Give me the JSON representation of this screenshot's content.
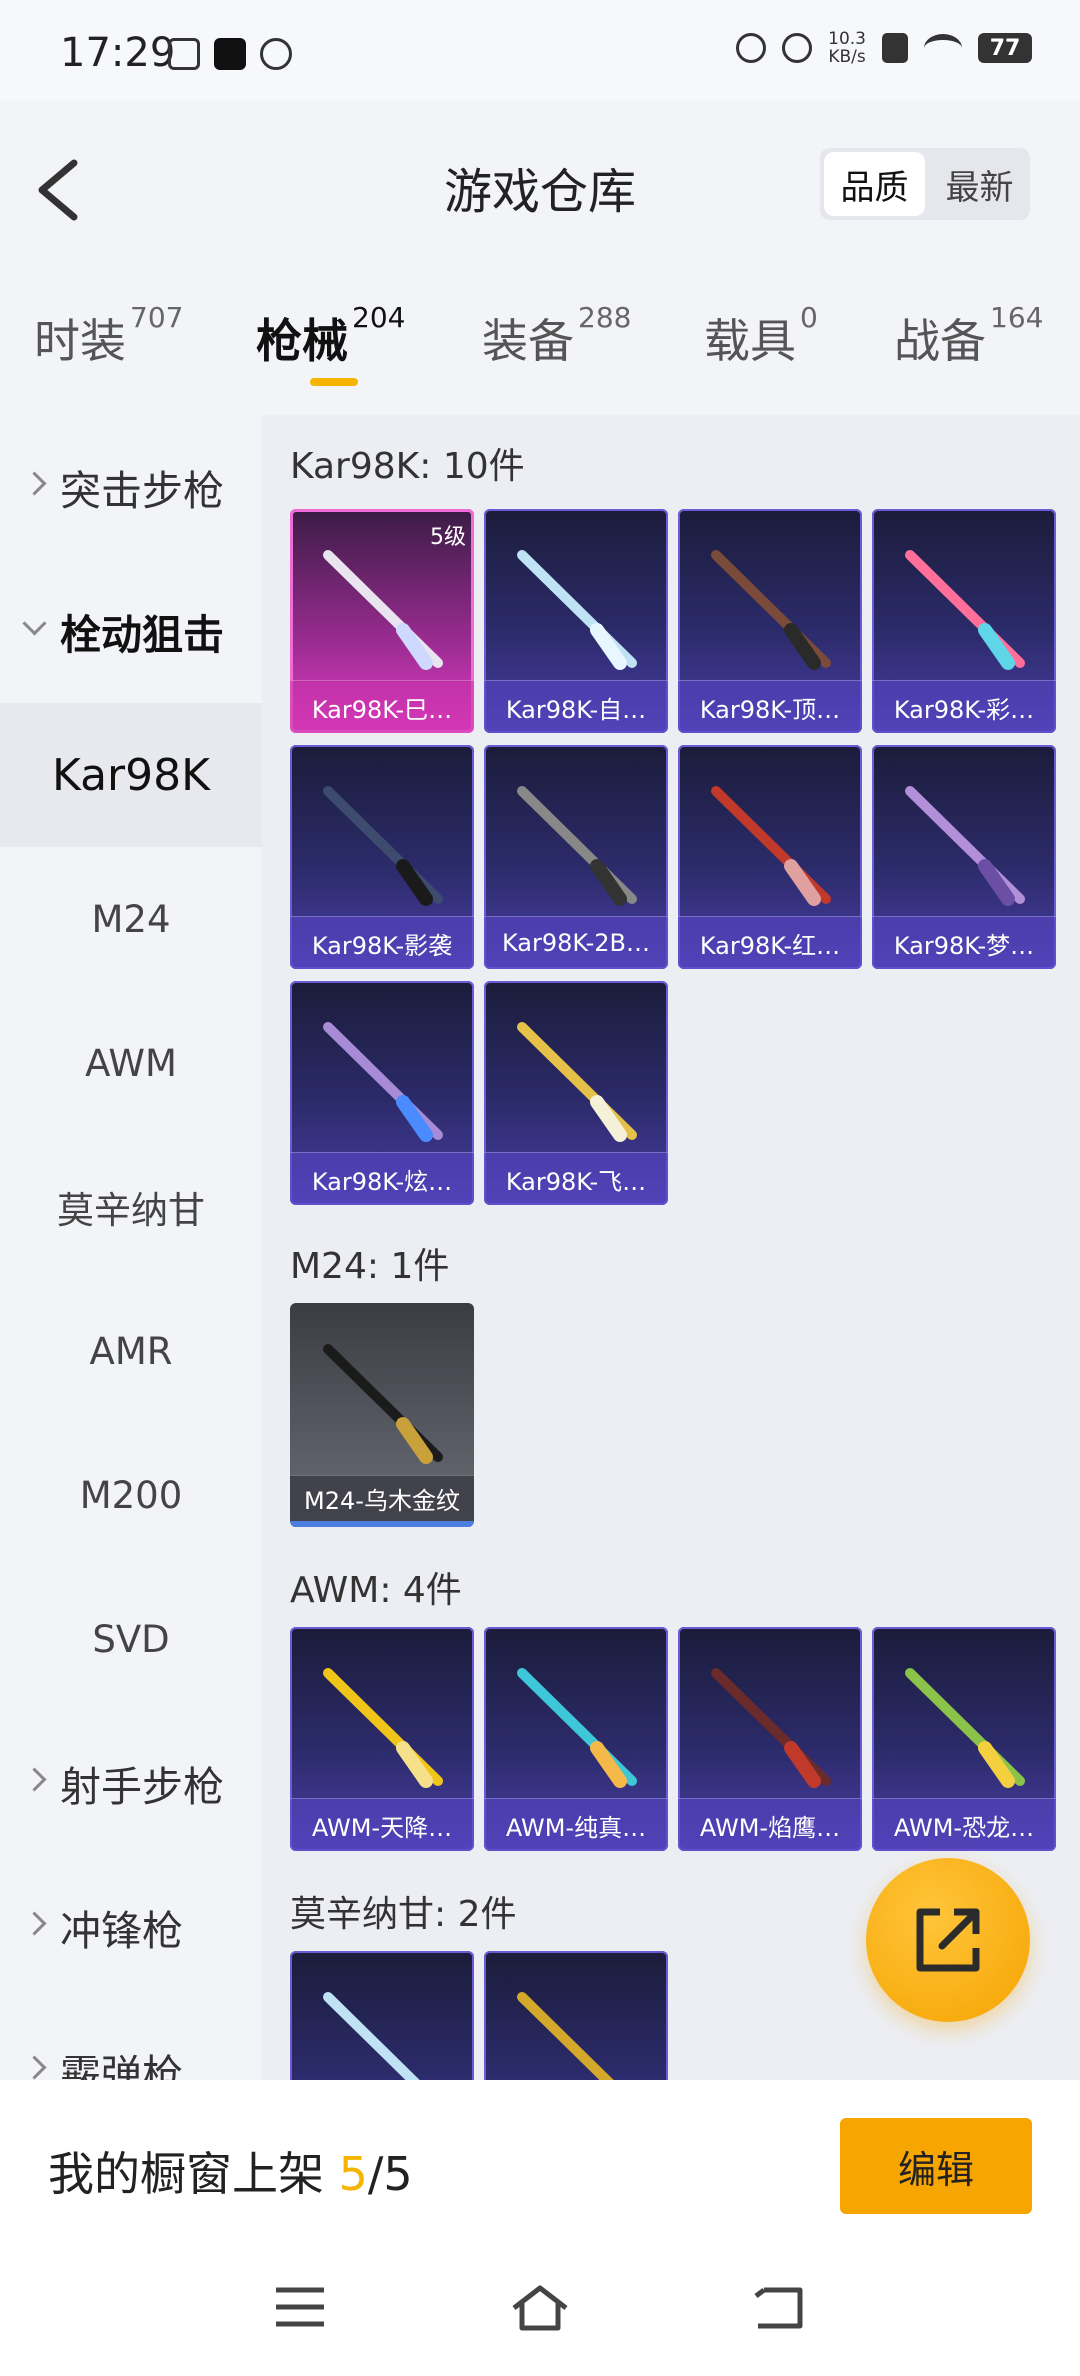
{
  "status": {
    "time": "17:29",
    "speed_top": "10.3",
    "speed_bottom": "KB/s",
    "battery": "77"
  },
  "header": {
    "title": "游戏仓库",
    "sort_options": [
      "品质",
      "最新"
    ]
  },
  "tabs": [
    {
      "label": "时装",
      "count": "707"
    },
    {
      "label": "枪械",
      "count": "204"
    },
    {
      "label": "装备",
      "count": "288"
    },
    {
      "label": "载具",
      "count": "0"
    },
    {
      "label": "战备",
      "count": "164"
    }
  ],
  "sidebar": [
    {
      "label": "突击步枪"
    },
    {
      "label": "栓动狙击"
    },
    {
      "label": "Kar98K"
    },
    {
      "label": "M24"
    },
    {
      "label": "AWM"
    },
    {
      "label": "莫辛纳甘"
    },
    {
      "label": "AMR"
    },
    {
      "label": "M200"
    },
    {
      "label": "SVD"
    },
    {
      "label": "射手步枪"
    },
    {
      "label": "冲锋枪"
    },
    {
      "label": "霰弹枪"
    }
  ],
  "sections": {
    "kar98k": {
      "title": "Kar98K: 10件",
      "level": "5级",
      "items": [
        "Kar98K-巳…",
        "Kar98K-自…",
        "Kar98K-顶…",
        "Kar98K-彩…",
        "Kar98K-影袭",
        "Kar98K-2B…",
        "Kar98K-红…",
        "Kar98K-梦…",
        "Kar98K-炫…",
        "Kar98K-飞…"
      ]
    },
    "m24": {
      "title": "M24: 1件",
      "items": [
        "M24-乌木金纹"
      ]
    },
    "awm": {
      "title": "AWM: 4件",
      "items": [
        "AWM-天降…",
        "AWM-纯真…",
        "AWM-焰鹰…",
        "AWM-恐龙…"
      ]
    },
    "mosin": {
      "title": "莫辛纳甘: 2件"
    }
  },
  "bottom": {
    "showcase_prefix": "我的橱窗上架 ",
    "showcase_count": "5",
    "showcase_total": "/5",
    "edit_label": "编辑"
  },
  "colors": {
    "accent": "#f4b400",
    "card_purple": "#4b3ea6",
    "card_pink": "#e43fc6"
  }
}
